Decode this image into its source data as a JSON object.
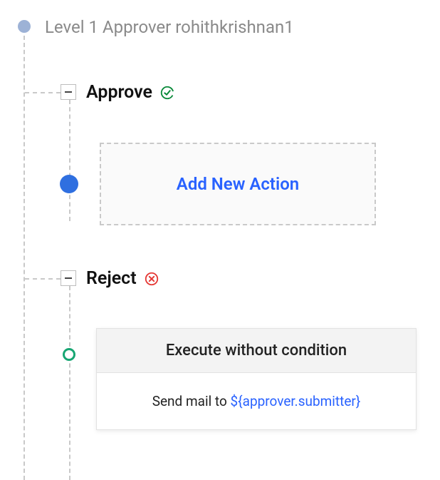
{
  "root": {
    "label": "Level 1 Approver rohithkrishnan1"
  },
  "branches": {
    "approve": {
      "label": "Approve",
      "icon": "approve-check-icon",
      "action_button": "Add New Action"
    },
    "reject": {
      "label": "Reject",
      "icon": "reject-x-icon",
      "card": {
        "header": "Execute without condition",
        "body_prefix": "Send mail to ",
        "body_variable": "${approver.submitter}"
      }
    }
  },
  "colors": {
    "accent_blue": "#2962ff",
    "approve_green": "#0a8a3a",
    "reject_red": "#e53935",
    "dash_gray": "#c9c9c9"
  }
}
